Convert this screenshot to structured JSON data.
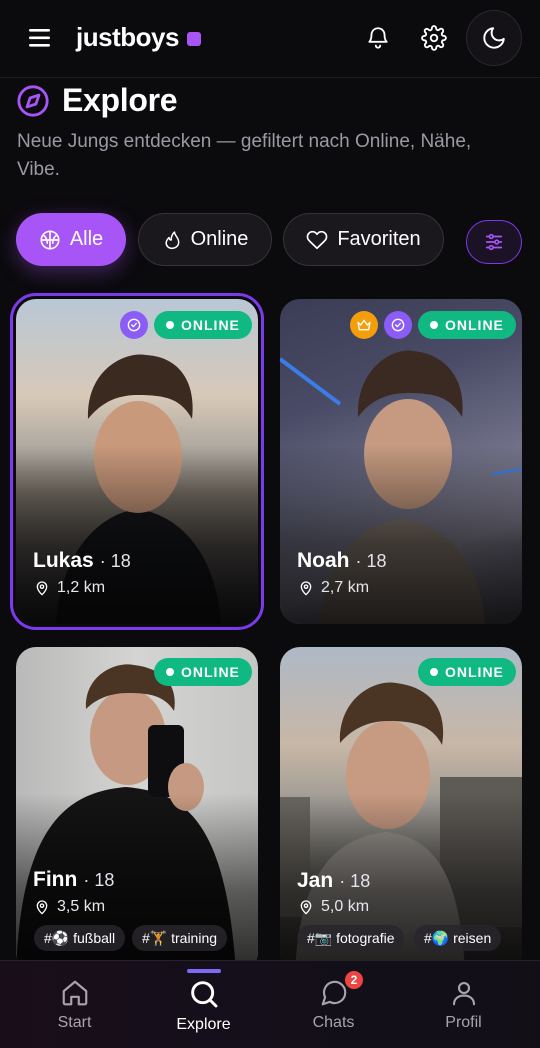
{
  "header": {
    "logo": "justboys",
    "icons": [
      "menu-icon",
      "bell-icon",
      "gear-icon",
      "moon-icon"
    ]
  },
  "page": {
    "title": "Explore",
    "subtitle": "Neue Jungs entdecken — gefiltert nach Online, Nähe, Vibe."
  },
  "filters": {
    "all": "Alle",
    "online": "Online",
    "favorites": "Favoriten",
    "active": "Alle"
  },
  "profiles": [
    {
      "name": "Lukas",
      "age": "· 18",
      "distance": "1,2 km",
      "status": "ONLINE",
      "verified": true,
      "premium": false,
      "selected": true,
      "tags": []
    },
    {
      "name": "Noah",
      "age": "· 18",
      "distance": "2,7 km",
      "status": "ONLINE",
      "verified": true,
      "premium": true,
      "selected": false,
      "tags": []
    },
    {
      "name": "Finn",
      "age": "· 18",
      "distance": "3,5 km",
      "status": "ONLINE",
      "verified": false,
      "premium": false,
      "selected": false,
      "tags": [
        "#⚽ fußball",
        "#🏋 training"
      ]
    },
    {
      "name": "Jan",
      "age": "· 18",
      "distance": "5,0 km",
      "status": "ONLINE",
      "verified": false,
      "premium": false,
      "selected": false,
      "tags": [
        "#📷 fotografie",
        "#🌍 reisen"
      ]
    }
  ],
  "nav": {
    "items": [
      "Start",
      "Explore",
      "Chats",
      "Profil"
    ],
    "active": "Explore",
    "chat_unread": "2"
  },
  "colors": {
    "accent": "#a855f7",
    "online": "#10b981",
    "premium": "#f59e0b",
    "badge": "#ef4444"
  }
}
